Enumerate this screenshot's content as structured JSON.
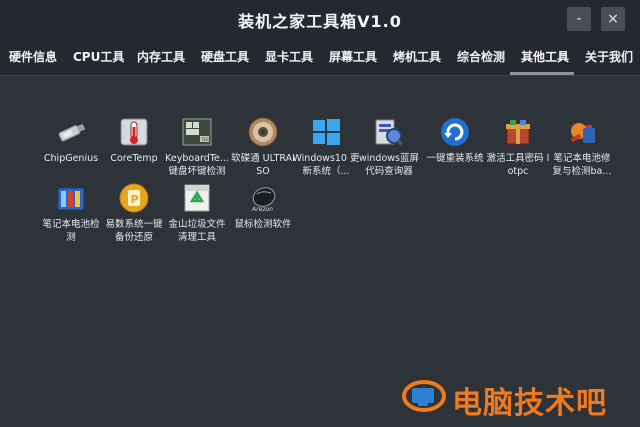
{
  "window": {
    "title": "装机之家工具箱V1.0",
    "minimize_label": "-",
    "close_label": "×"
  },
  "tabs": [
    {
      "label": "硬件信息"
    },
    {
      "label": "CPU工具"
    },
    {
      "label": "内存工具"
    },
    {
      "label": "硬盘工具"
    },
    {
      "label": "显卡工具"
    },
    {
      "label": "屏幕工具"
    },
    {
      "label": "烤机工具"
    },
    {
      "label": "综合检测"
    },
    {
      "label": "其他工具",
      "active": true
    },
    {
      "label": "关于我们"
    }
  ],
  "tools": [
    {
      "label": "ChipGenius",
      "icon": "usb-drive-icon"
    },
    {
      "label": "CoreTemp",
      "icon": "thermometer-icon"
    },
    {
      "label": "KeyboardTe... 键盘坏键检测",
      "icon": "keyboard-test-icon"
    },
    {
      "label": "软碟通 ULTRAISO",
      "icon": "disc-icon"
    },
    {
      "label": "Windows10 更新系统（...",
      "icon": "windows-logo-icon"
    },
    {
      "label": "windows蓝屏 代码查询器",
      "icon": "bluescreen-viewer-icon"
    },
    {
      "label": "一键重装系统",
      "icon": "reinstall-system-icon"
    },
    {
      "label": "激活工具密码 lotpc",
      "icon": "activation-tool-icon"
    },
    {
      "label": "笔记本电池修 复与检测ba...",
      "icon": "battery-repair-icon"
    },
    {
      "label": "笔记本电池检 测",
      "icon": "battery-test-icon"
    },
    {
      "label": "易数系统一键 备份还原",
      "icon": "backup-restore-icon"
    },
    {
      "label": "金山垃圾文件 清理工具",
      "icon": "recycle-cleaner-icon"
    },
    {
      "label": "鼠标检测软件",
      "icon": "mouse-test-icon"
    }
  ],
  "watermark": {
    "text": "电脑技术吧"
  },
  "colors": {
    "background": "#2e3239",
    "titlebar": "#25282e",
    "watermark": "#f07a1c"
  }
}
